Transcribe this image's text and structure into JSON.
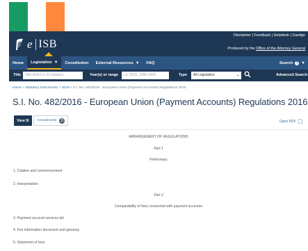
{
  "colors": {
    "flag_green": "#169b62",
    "flag_white": "#ffffff",
    "flag_orange": "#ff883e",
    "header": "#1e3754",
    "nav": "#2c5582",
    "accent": "#f6b31b"
  },
  "logo": {
    "e": "e",
    "isb": "ISB"
  },
  "top_links": {
    "disclaimer": "Disclaimer",
    "feedback": "Feedback",
    "helpdesk": "Helpdesk",
    "gaeilge": "Gaeilge"
  },
  "produced": {
    "prefix": "Produced by the",
    "office": "Office of the Attorney General"
  },
  "nav": {
    "items": [
      "Home",
      "Legislation",
      "Constitution",
      "External Resources",
      "FAQ"
    ],
    "search": "Search"
  },
  "filter": {
    "title_label": "Title",
    "title_placeholder": "Title of Act or SI contains",
    "year_label": "Year(s) or range",
    "year_placeholder": "i.e. 2015, 1990-1999",
    "type_label": "Type",
    "type_value": "All Legislation",
    "advanced": "Advanced Search"
  },
  "breadcrumb": [
    "Home",
    "Statutory Instruments",
    "2016",
    "S.I. No. 482/2016 - European Union (Payment Accounts) Regulations 2016."
  ],
  "page_title": "S.I. No. 482/2016 - European Union (Payment Accounts) Regulations 2016.",
  "buttons": {
    "view_si": "View SI",
    "amendments": "Amendments",
    "amendments_count": "0",
    "open_pdf": "Open PDF"
  },
  "content": {
    "arrangement": "ARRANGEMENT OF REGULATIONS",
    "part1": "Part 1",
    "part1_title": "Preliminary",
    "items1": [
      "1. Citation and commencement",
      "2. Interpretation"
    ],
    "part2": "Part 2",
    "part2_title": "Comparability of fees connected with payment accounts",
    "items2": [
      "3. Payment account services list",
      "4. Fee information document and glossary",
      "5. Statement of fees"
    ]
  }
}
